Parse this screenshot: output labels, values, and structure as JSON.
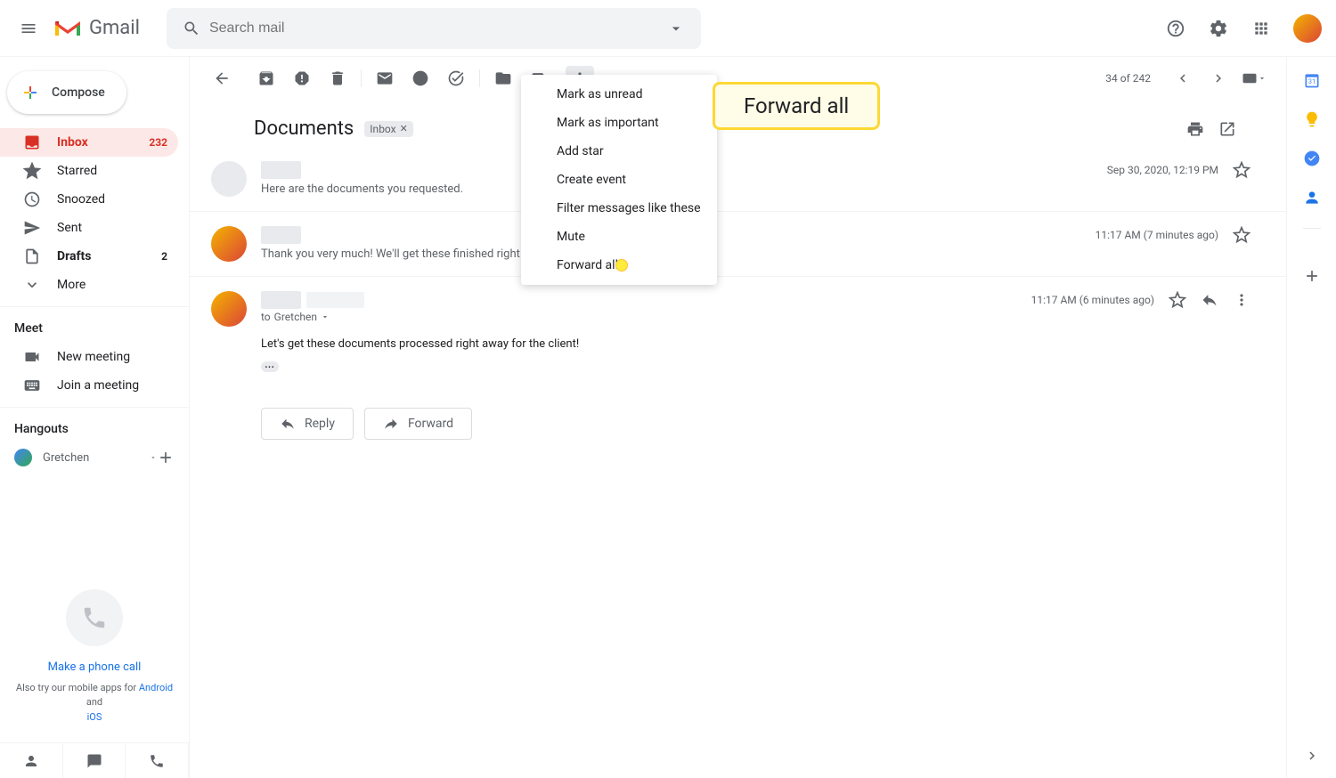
{
  "header": {
    "logo_text": "Gmail",
    "search_placeholder": "Search mail"
  },
  "sidebar": {
    "compose": "Compose",
    "items": [
      {
        "label": "Inbox",
        "count": "232",
        "active": true
      },
      {
        "label": "Starred"
      },
      {
        "label": "Snoozed"
      },
      {
        "label": "Sent"
      },
      {
        "label": "Drafts",
        "count": "2"
      },
      {
        "label": "More"
      }
    ],
    "meet_header": "Meet",
    "meet_items": [
      {
        "label": "New meeting"
      },
      {
        "label": "Join a meeting"
      }
    ],
    "hangouts_header": "Hangouts",
    "hangouts_name": "Gretchen",
    "phone_link": "Make a phone call",
    "mobile_text_pre": "Also try our mobile apps for ",
    "mobile_android": "Android",
    "mobile_and": " and ",
    "mobile_ios": "iOS"
  },
  "toolbar": {
    "page_info_current": "34",
    "page_info_of": " of ",
    "page_info_total": "242"
  },
  "subject": {
    "title": "Documents",
    "chip": "Inbox"
  },
  "dropdown": {
    "items": [
      "Mark as unread",
      "Mark as important",
      "Add star",
      "Create event",
      "Filter messages like these",
      "Mute",
      "Forward all"
    ]
  },
  "callout": {
    "text": "Forward all"
  },
  "messages": [
    {
      "snippet": "Here are the documents you requested.",
      "timestamp": "Sep 30, 2020, 12:19 PM"
    },
    {
      "snippet": "Thank you very much! We'll get these finished right away!",
      "timestamp": "11:17 AM (7 minutes ago)"
    },
    {
      "to_prefix": "to ",
      "to_name": "Gretchen",
      "body": "Let's get these documents processed right away for the client!",
      "timestamp": "11:17 AM (6 minutes ago)"
    }
  ],
  "actions": {
    "reply": "Reply",
    "forward": "Forward"
  }
}
